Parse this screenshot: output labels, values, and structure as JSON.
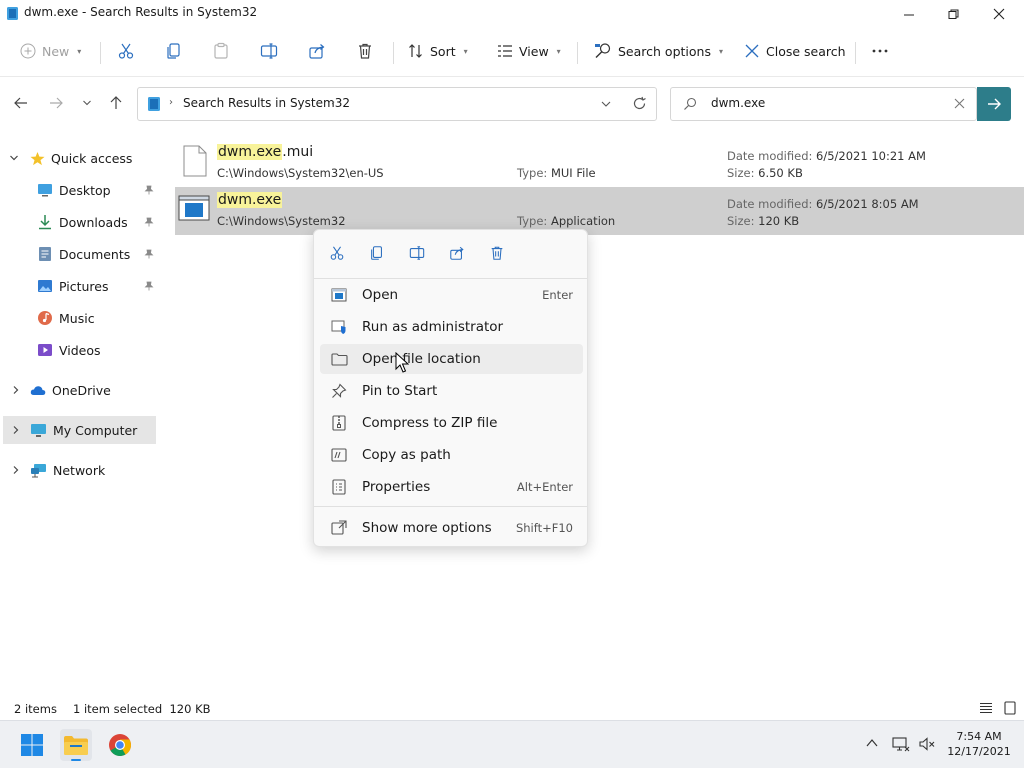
{
  "window": {
    "title": "dwm.exe - Search Results in System32"
  },
  "commandbar": {
    "new": "New",
    "sort": "Sort",
    "view": "View",
    "search_options": "Search options",
    "close_search": "Close search"
  },
  "address": {
    "location": "Search Results in System32"
  },
  "search": {
    "value": "dwm.exe"
  },
  "sidebar": {
    "quick_access": "Quick access",
    "items": [
      {
        "label": "Desktop",
        "icon": "desktop-icon",
        "pinned": true
      },
      {
        "label": "Downloads",
        "icon": "downloads-icon",
        "pinned": true
      },
      {
        "label": "Documents",
        "icon": "documents-icon",
        "pinned": true
      },
      {
        "label": "Pictures",
        "icon": "pictures-icon",
        "pinned": true
      },
      {
        "label": "Music",
        "icon": "music-icon",
        "pinned": false
      },
      {
        "label": "Videos",
        "icon": "videos-icon",
        "pinned": false
      }
    ],
    "onedrive": "OneDrive",
    "my_computer": "My Computer",
    "network": "Network"
  },
  "files": [
    {
      "name_highlight": "dwm.exe",
      "name_rest": ".mui",
      "path": "C:\\Windows\\System32\\en-US",
      "type_label": "Type:",
      "type": "MUI File",
      "date_label": "Date modified:",
      "date": "6/5/2021 10:21 AM",
      "size_label": "Size:",
      "size": "6.50 KB"
    },
    {
      "name_highlight": "dwm.exe",
      "name_rest": "",
      "path": "C:\\Windows\\System32",
      "type_label": "Type:",
      "type": "Application",
      "date_label": "Date modified:",
      "date": "6/5/2021 8:05 AM",
      "size_label": "Size:",
      "size": "120 KB"
    }
  ],
  "context_menu": {
    "items": [
      {
        "label": "Open",
        "shortcut": "Enter",
        "icon": "open-icon"
      },
      {
        "label": "Run as administrator",
        "shortcut": "",
        "icon": "shield-icon"
      },
      {
        "label": "Open file location",
        "shortcut": "",
        "icon": "folder-icon"
      },
      {
        "label": "Pin to Start",
        "shortcut": "",
        "icon": "pin-icon"
      },
      {
        "label": "Compress to ZIP file",
        "shortcut": "",
        "icon": "zip-icon"
      },
      {
        "label": "Copy as path",
        "shortcut": "",
        "icon": "copy-path-icon"
      },
      {
        "label": "Properties",
        "shortcut": "Alt+Enter",
        "icon": "properties-icon"
      }
    ],
    "more": {
      "label": "Show more options",
      "shortcut": "Shift+F10"
    }
  },
  "statusbar": {
    "item_count": "2 items",
    "selection": "1 item selected  120 KB"
  },
  "taskbar": {
    "time": "7:54 AM",
    "date": "12/17/2021"
  },
  "colors": {
    "accent": "#2d7d8a",
    "highlight": "#f8f39a",
    "selected_row": "#cfcfcf",
    "folder": "#f3b92f"
  }
}
